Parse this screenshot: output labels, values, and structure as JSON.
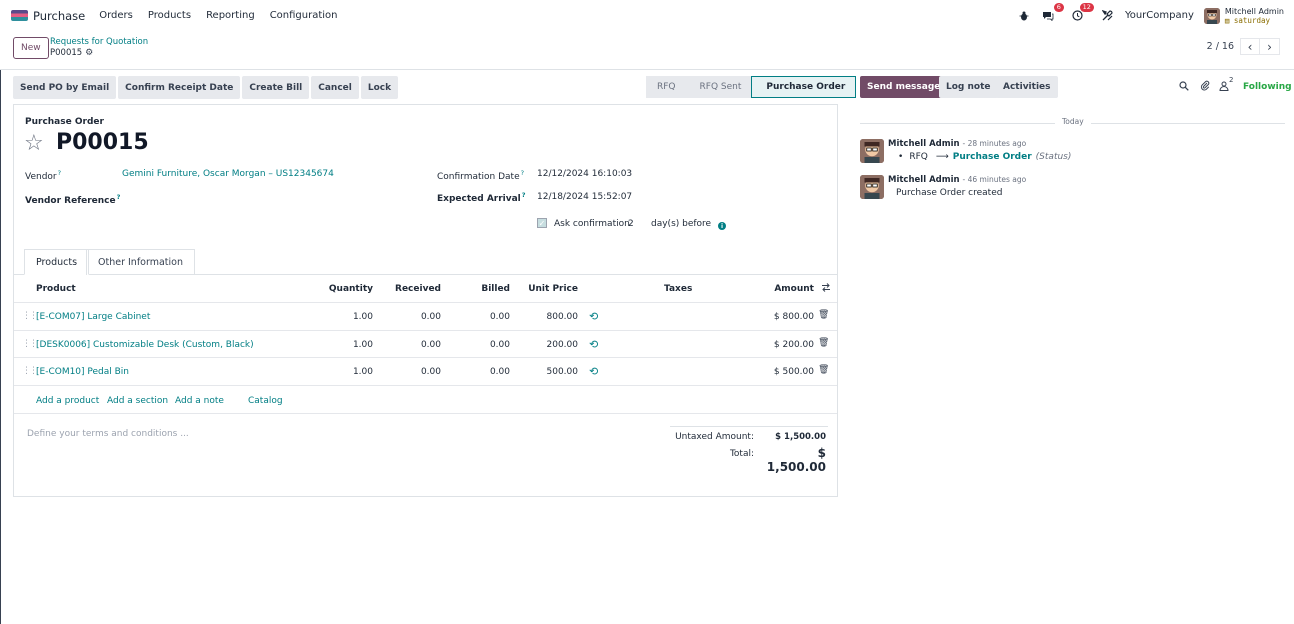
{
  "nav": {
    "app_name": "Purchase",
    "menu": [
      "Orders",
      "Products",
      "Reporting",
      "Configuration"
    ],
    "messages_badge": "6",
    "activities_badge": "12",
    "company": "YourCompany",
    "user_name": "Mitchell Admin",
    "database": "saturday"
  },
  "control": {
    "new_label": "New",
    "breadcrumb_parent": "Requests for Quotation",
    "breadcrumb_current": "P00015",
    "pager_value": "2 / 16"
  },
  "actions": [
    "Send PO by Email",
    "Confirm Receipt Date",
    "Create Bill",
    "Cancel",
    "Lock"
  ],
  "status": {
    "steps": [
      "RFQ",
      "RFQ Sent",
      "Purchase Order"
    ],
    "active": "Purchase Order"
  },
  "form": {
    "type_label": "Purchase Order",
    "name": "P00015",
    "vendor_label": "Vendor",
    "vendor_value": "Gemini Furniture, Oscar Morgan – US12345674",
    "vendor_ref_label": "Vendor Reference",
    "confirmation_label": "Confirmation Date",
    "confirmation_value": "12/12/2024 16:10:03",
    "arrival_label": "Expected Arrival",
    "arrival_value": "12/18/2024 15:52:07",
    "ask_confirmation_label": "Ask confirmation",
    "ask_confirmation_days": "2",
    "days_before_label": "day(s) before",
    "help_mark": "?"
  },
  "tabs": [
    "Products",
    "Other Information"
  ],
  "table": {
    "headers": {
      "product": "Product",
      "quantity": "Quantity",
      "received": "Received",
      "billed": "Billed",
      "unit_price": "Unit Price",
      "taxes": "Taxes",
      "amount": "Amount"
    },
    "rows": [
      {
        "product": "[E-COM07] Large Cabinet",
        "quantity": "1.00",
        "received": "0.00",
        "billed": "0.00",
        "unit_price": "800.00",
        "taxes": "",
        "amount": "$ 800.00"
      },
      {
        "product": "[DESK0006] Customizable Desk (Custom, Black)",
        "quantity": "1.00",
        "received": "0.00",
        "billed": "0.00",
        "unit_price": "200.00",
        "taxes": "",
        "amount": "$ 200.00"
      },
      {
        "product": "[E-COM10] Pedal Bin",
        "quantity": "1.00",
        "received": "0.00",
        "billed": "0.00",
        "unit_price": "500.00",
        "taxes": "",
        "amount": "$ 500.00"
      }
    ],
    "add_product": "Add a product",
    "add_section": "Add a section",
    "add_note": "Add a note",
    "catalog": "Catalog"
  },
  "terms_placeholder": "Define your terms and conditions ...",
  "totals": {
    "untaxed_label": "Untaxed Amount:",
    "untaxed_value": "$ 1,500.00",
    "total_label": "Total:",
    "total_value": "$ 1,500.00"
  },
  "chatter": {
    "send_message": "Send message",
    "log_note": "Log note",
    "activities": "Activities",
    "followers_count": "2",
    "following": "Following",
    "today": "Today",
    "messages": [
      {
        "author": "Mitchell Admin",
        "time": "- 28 minutes ago",
        "tracking_old": "RFQ",
        "tracking_arrow": "⟶",
        "tracking_new": "Purchase Order",
        "tracking_field": "(Status)"
      },
      {
        "author": "Mitchell Admin",
        "time": "- 46 minutes ago",
        "body": "Purchase Order created"
      }
    ]
  },
  "colors": {
    "brand": "#714b67",
    "link": "#017e84",
    "badge": "#dc3545",
    "following": "#28a745"
  }
}
